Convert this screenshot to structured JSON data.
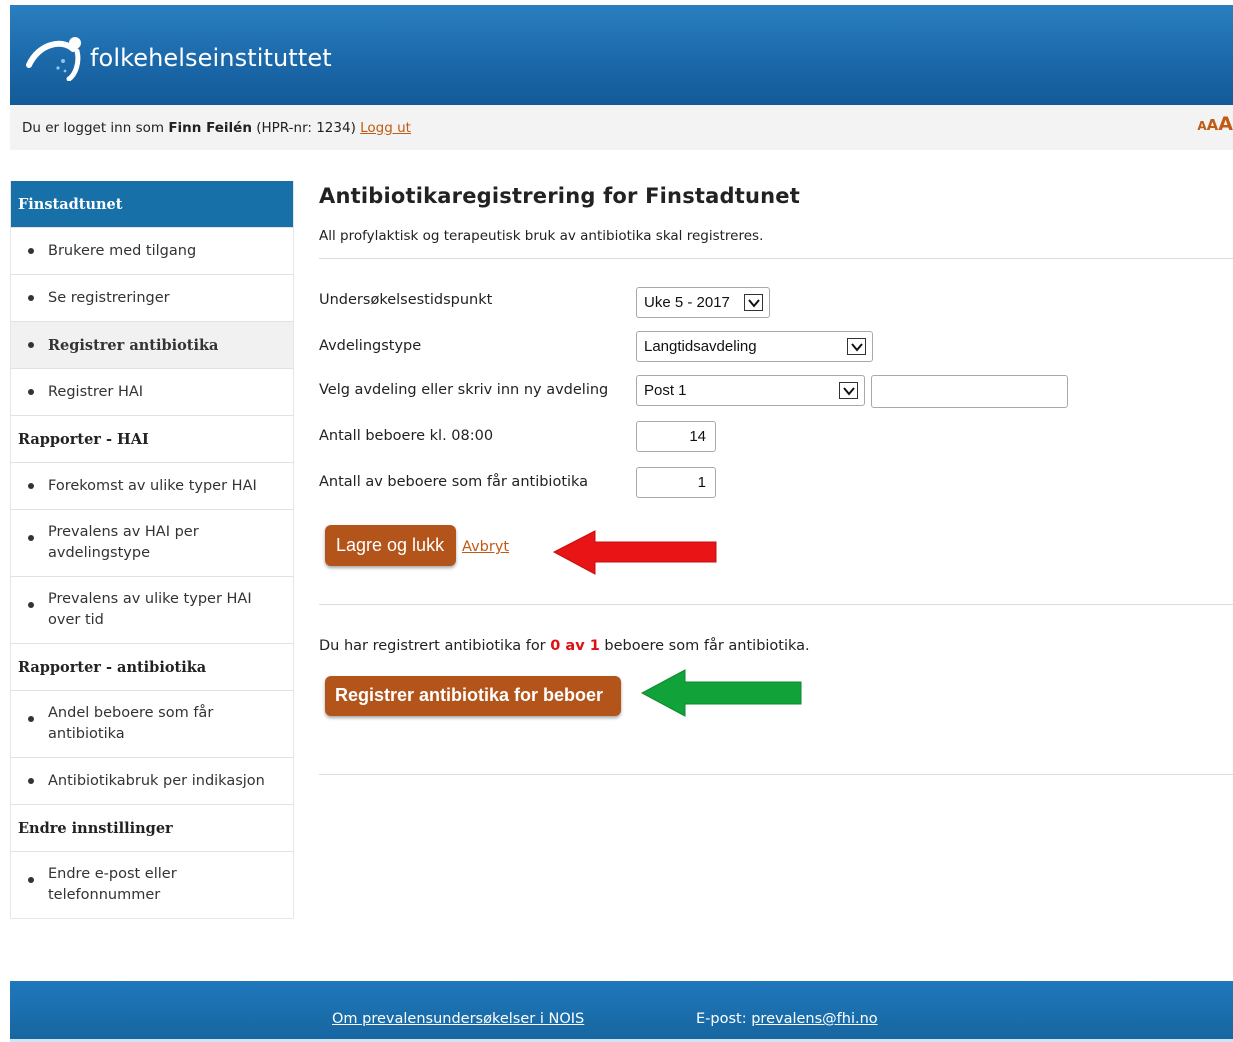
{
  "header": {
    "logo_text": "folkehelseinstituttet"
  },
  "loginbar": {
    "prefix": "Du er logget inn som ",
    "user_name": "Finn Feilén",
    "hpr": " (HPR-nr: 1234) ",
    "logout_label": "Logg ut",
    "textsize_small": "A",
    "textsize_medium": "A",
    "textsize_large": "A"
  },
  "sidebar": {
    "title": "Finstadtunet",
    "items_group1": [
      {
        "label": "Brukere med tilgang"
      },
      {
        "label": "Se registreringer"
      },
      {
        "label": "Registrer antibiotika",
        "active": true
      },
      {
        "label": "Registrer HAI"
      }
    ],
    "section_hai": "Rapporter - HAI",
    "items_hai": [
      {
        "label": "Forekomst av ulike typer HAI"
      },
      {
        "label": "Prevalens av HAI per avdelingstype"
      },
      {
        "label": "Prevalens av ulike typer HAI over tid"
      }
    ],
    "section_antibiotika": "Rapporter - antibiotika",
    "items_antibiotika": [
      {
        "label": "Andel beboere som får antibiotika"
      },
      {
        "label": "Antibiotikabruk per indikasjon"
      }
    ],
    "section_settings": "Endre innstillinger",
    "items_settings": [
      {
        "label": "Endre e-post eller telefonnummer"
      }
    ]
  },
  "main": {
    "title": "Antibiotikaregistrering for Finstadtunet",
    "intro": "All profylaktisk og terapeutisk bruk av antibiotika skal registreres.",
    "form": {
      "survey_time_label": "Undersøkelsestidspunkt",
      "survey_time_value": "Uke 5 - 2017",
      "ward_type_label": "Avdelingstype",
      "ward_type_value": "Langtidsavdeling",
      "ward_label": "Velg avdeling eller skriv inn ny avdeling",
      "ward_value": "Post 1",
      "ward_new_value": "",
      "residents_label": "Antall beboere kl. 08:00",
      "residents_value": "14",
      "antibiotic_residents_label": "Antall av beboere som får antibiotika",
      "antibiotic_residents_value": "1"
    },
    "save_button": "Lagre og lukk",
    "cancel_link": "Avbryt",
    "status_prefix": "Du har registrert antibiotika for ",
    "status_count": "0 av 1",
    "status_suffix": " beboere som får antibiotika.",
    "register_button": "Registrer antibiotika for beboer"
  },
  "annotations": {
    "arrow_red_color": "#e81416",
    "arrow_green_color": "#12a23a"
  },
  "footer": {
    "about_link": "Om prevalensundersøkelser i NOIS",
    "email_label": "E-post: ",
    "email_link": "prevalens@fhi.no"
  },
  "colors": {
    "header_blue": "#1a67a8",
    "sidebar_head": "#1870a8",
    "button_brown": "#b3541b",
    "link_orange": "#c15a14",
    "status_red": "#e01010"
  }
}
